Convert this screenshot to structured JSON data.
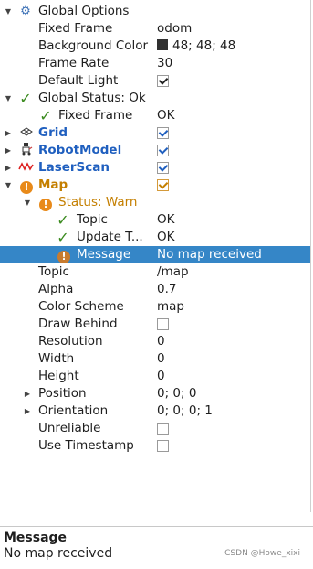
{
  "tree": {
    "global_options": {
      "label": "Global Options",
      "fixed_frame": {
        "label": "Fixed Frame",
        "value": "odom"
      },
      "background_color": {
        "label": "Background Color",
        "value": "48; 48; 48",
        "color": "#303030"
      },
      "frame_rate": {
        "label": "Frame Rate",
        "value": "30"
      },
      "default_light": {
        "label": "Default Light",
        "checked": true
      }
    },
    "global_status": {
      "label": "Global Status: Ok",
      "fixed_frame": {
        "label": "Fixed Frame",
        "value": "OK"
      }
    },
    "displays": {
      "grid": {
        "label": "Grid",
        "checked": true,
        "icon": "grid-icon"
      },
      "robot_model": {
        "label": "RobotModel",
        "checked": true,
        "icon": "robot-icon"
      },
      "laser_scan": {
        "label": "LaserScan",
        "checked": true,
        "icon": "laserscan-icon"
      }
    },
    "map": {
      "label": "Map",
      "checked": true,
      "status": {
        "label": "Status: Warn",
        "topic": {
          "label": "Topic",
          "value": "OK"
        },
        "update": {
          "label": "Update T...",
          "value": "OK"
        },
        "message": {
          "label": "Message",
          "value": "No map received"
        }
      },
      "topic": {
        "label": "Topic",
        "value": "/map"
      },
      "alpha": {
        "label": "Alpha",
        "value": "0.7"
      },
      "color_scheme": {
        "label": "Color Scheme",
        "value": "map"
      },
      "draw_behind": {
        "label": "Draw Behind",
        "checked": false
      },
      "resolution": {
        "label": "Resolution",
        "value": "0"
      },
      "width": {
        "label": "Width",
        "value": "0"
      },
      "height": {
        "label": "Height",
        "value": "0"
      },
      "position": {
        "label": "Position",
        "value": "0; 0; 0"
      },
      "orientation": {
        "label": "Orientation",
        "value": "0; 0; 0; 1"
      },
      "unreliable": {
        "label": "Unreliable",
        "checked": false
      },
      "use_timestamp": {
        "label": "Use Timestamp",
        "checked": false
      }
    }
  },
  "description": {
    "title": "Message",
    "body": "No map received"
  },
  "watermark": "CSDN @Howe_xixi",
  "colors": {
    "selection": "#3586c7",
    "display_blue": "#1f5fbf",
    "warn_orange": "#c47f00",
    "ok_green": "#3a8a1e"
  }
}
